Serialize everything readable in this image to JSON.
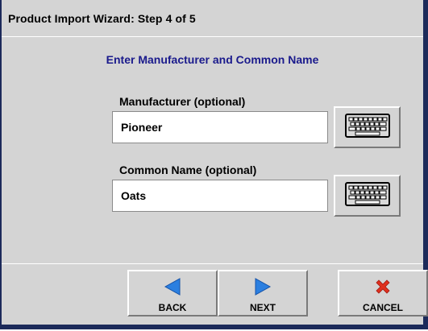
{
  "dialog": {
    "title": "Product Import Wizard:  Step 4 of 5",
    "instruction": "Enter Manufacturer and Common Name"
  },
  "fields": {
    "manufacturer": {
      "label": "Manufacturer (optional)",
      "value": "Pioneer"
    },
    "common_name": {
      "label": "Common Name (optional)",
      "value": "Oats"
    }
  },
  "buttons": {
    "back": {
      "label": "BACK",
      "icon": "arrow-left-icon"
    },
    "next": {
      "label": "NEXT",
      "icon": "arrow-right-icon"
    },
    "cancel": {
      "label": "CANCEL",
      "icon": "x-icon"
    },
    "keyboard_icon": "keyboard-icon"
  },
  "colors": {
    "frame": "#1c2a5a",
    "background": "#d4d4d4",
    "instruction_text": "#1a1a8c",
    "arrow_blue": "#2b7fe0",
    "cancel_red": "#e0301e"
  }
}
